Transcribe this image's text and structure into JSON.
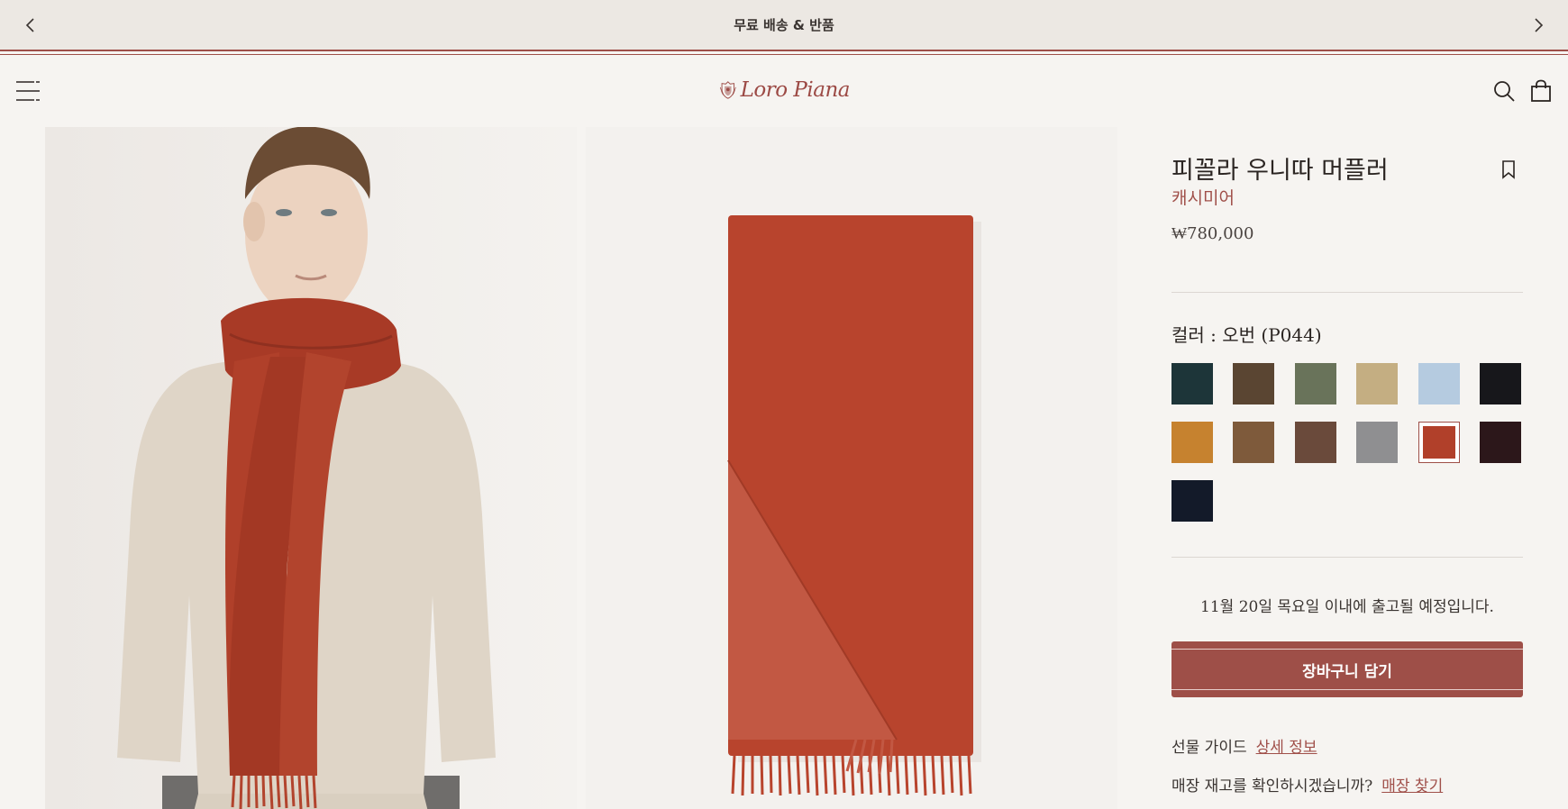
{
  "announcement": {
    "text": "무료 배송 & 반품"
  },
  "header": {
    "logo_text": "Loro Piana"
  },
  "product": {
    "title": "피꼴라 우니따 머플러",
    "material": "캐시미어",
    "price": "₩780,000",
    "color_label": "컬러 : 오번 (P044)",
    "swatches": [
      {
        "color": "#1d3539"
      },
      {
        "color": "#5a4532"
      },
      {
        "color": "#69735a"
      },
      {
        "color": "#c4ae82"
      },
      {
        "color": "#b5cbe0"
      },
      {
        "color": "#17171b"
      },
      {
        "color": "#c6822f"
      },
      {
        "color": "#7e5a3b"
      },
      {
        "color": "#6a4a3b"
      },
      {
        "color": "#8f8f91"
      },
      {
        "color": "#b1402a",
        "selected": true
      },
      {
        "color": "#2c171a"
      },
      {
        "color": "#131a29"
      }
    ],
    "shipping": "11월 20일 목요일 이내에 출고될 예정입니다.",
    "add_to_cart": "장바구니 담기",
    "gift_guide_label": "선물 가이드",
    "gift_guide_link": "상세 정보",
    "store_label": "매장 재고를 확인하시겠습니까?",
    "store_link": "매장 찾기"
  },
  "colors": {
    "accent": "#9e4f48",
    "background": "#f6f4f1",
    "scarf": "#b8442d"
  }
}
